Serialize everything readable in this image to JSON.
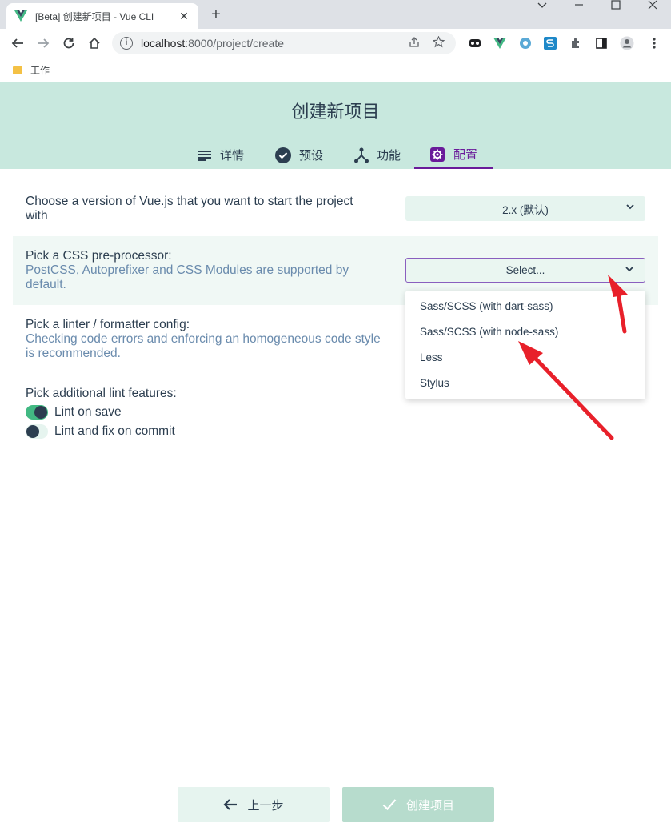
{
  "browser": {
    "tab_title": "[Beta] 创建新项目 - Vue CLI",
    "close_glyph": "✕",
    "new_tab_glyph": "+",
    "url_host": "localhost",
    "url_path": ":8000/project/create",
    "bookmark_folder": "工作",
    "colors": {
      "tabstrip": "#dee1e6",
      "omnibox": "#f1f3f4"
    }
  },
  "header": {
    "title": "创建新项目",
    "steps": [
      {
        "label": "详情",
        "icon": "list-icon"
      },
      {
        "label": "预设",
        "icon": "check-circle-icon"
      },
      {
        "label": "功能",
        "icon": "fork-icon"
      },
      {
        "label": "配置",
        "icon": "settings-icon",
        "active": true
      }
    ],
    "colors": {
      "background": "#c8e8de",
      "active": "#6a1b9a"
    }
  },
  "form": {
    "vue_version": {
      "label": "Choose a version of Vue.js that you want to start the project with",
      "value": "2.x (默认)"
    },
    "css_preprocessor": {
      "label": "Pick a CSS pre-processor:",
      "description": "PostCSS, Autoprefixer and CSS Modules are supported by default.",
      "value": "Select...",
      "options": [
        "Sass/SCSS (with dart-sass)",
        "Sass/SCSS (with node-sass)",
        "Less",
        "Stylus"
      ]
    },
    "linter": {
      "label": "Pick a linter / formatter config:",
      "description": "Checking code errors and enforcing an homogeneous code style is recommended."
    },
    "lint_features": {
      "label": "Pick additional lint features:",
      "items": [
        {
          "label": "Lint on save",
          "on": true
        },
        {
          "label": "Lint and fix on commit",
          "on": false
        }
      ]
    }
  },
  "footer": {
    "prev_label": "上一步",
    "create_label": "创建项目"
  },
  "annotation_color": "#e8202a"
}
